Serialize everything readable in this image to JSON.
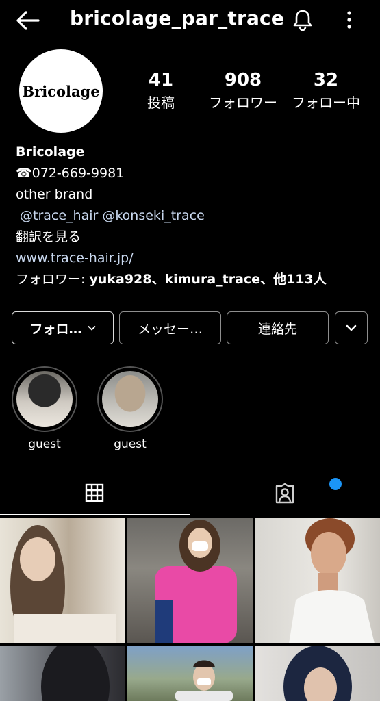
{
  "header": {
    "title": "bricolage_par_trace",
    "back_icon": "back-arrow-icon",
    "bell_icon": "bell-icon",
    "more_icon": "more-vertical-icon"
  },
  "profile": {
    "avatar_text": "Bricolage",
    "stats": [
      {
        "value": "41",
        "label": "投稿"
      },
      {
        "value": "908",
        "label": "フォロワー"
      },
      {
        "value": "32",
        "label": "フォロー中"
      }
    ]
  },
  "bio": {
    "name": "Bricolage",
    "phone": "☎072-669-9981",
    "line1": "other brand",
    "mentions": "@trace_hair @konseki_trace",
    "translate": "翻訳を見る",
    "website": "www.trace-hair.jp/",
    "followed_by_prefix": "フォロワー: ",
    "followed_by_names": "yuka928、kimura_trace、他113人"
  },
  "buttons": {
    "follow": "フォロ…",
    "message": "メッセー…",
    "contact": "連絡先"
  },
  "highlights": [
    {
      "label": "guest"
    },
    {
      "label": "guest"
    }
  ],
  "tabs": {
    "grid_icon": "grid-icon",
    "tagged_icon": "tagged-person-icon"
  },
  "colors": {
    "background": "#000000",
    "link": "#c8d7ee",
    "notification_dot": "#1b95f7"
  }
}
